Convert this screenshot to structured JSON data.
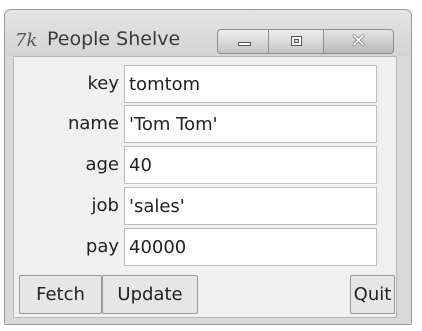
{
  "window": {
    "title": "People Shelve",
    "icon_label": "7k",
    "controls": {
      "minimize": "minimize",
      "maximize": "maximize",
      "close": "✕"
    }
  },
  "fields": [
    {
      "label": "key",
      "value": "tomtom"
    },
    {
      "label": "name",
      "value": "'Tom Tom'"
    },
    {
      "label": "age",
      "value": "40"
    },
    {
      "label": "job",
      "value": "'sales'"
    },
    {
      "label": "pay",
      "value": "40000"
    }
  ],
  "buttons": {
    "fetch": "Fetch",
    "update": "Update",
    "quit": "Quit"
  },
  "icons": {
    "app": "tk-feather-icon",
    "minimize": "minimize-icon",
    "maximize": "maximize-icon",
    "close": "close-icon"
  }
}
